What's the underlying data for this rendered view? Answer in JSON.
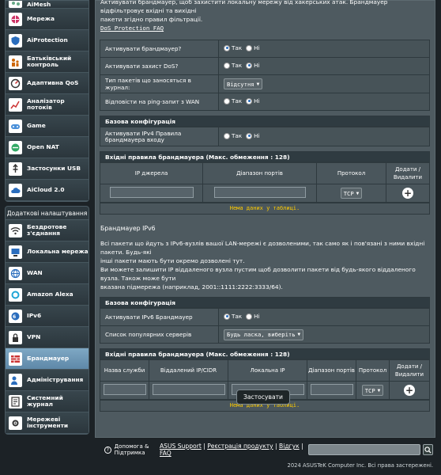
{
  "sidebar": {
    "items": [
      {
        "label": "AiMesh",
        "icon": "aimesh-icon"
      },
      {
        "label": "Мережа",
        "icon": "network-icon"
      },
      {
        "label": "AiProtection",
        "icon": "aiprotection-icon"
      },
      {
        "label": "Батьківський контроль",
        "icon": "parental-control-icon"
      },
      {
        "label": "Адаптивна QoS",
        "icon": "qos-icon"
      },
      {
        "label": "Аналізатор потоків",
        "icon": "traffic-analyzer-icon"
      },
      {
        "label": "Game",
        "icon": "game-icon"
      },
      {
        "label": "Open NAT",
        "icon": "open-nat-icon"
      },
      {
        "label": "Застосунки USB",
        "icon": "usb-icon"
      },
      {
        "label": "AiCloud 2.0",
        "icon": "aicloud-icon"
      }
    ],
    "advanced_header": "Додаткові налаштування",
    "advanced": [
      {
        "label": "Бездротове з'єднання",
        "icon": "wireless-icon"
      },
      {
        "label": "Локальна мережа",
        "icon": "lan-icon"
      },
      {
        "label": "WAN",
        "icon": "wan-icon"
      },
      {
        "label": "Amazon Alexa",
        "icon": "alexa-icon"
      },
      {
        "label": "IPv6",
        "icon": "ipv6-icon"
      },
      {
        "label": "VPN",
        "icon": "vpn-icon"
      },
      {
        "label": "Брандмауер",
        "icon": "firewall-icon"
      },
      {
        "label": "Адміністрування",
        "icon": "administration-icon"
      },
      {
        "label": "Системний журнал",
        "icon": "system-log-icon"
      },
      {
        "label": "Мережеві інструменти",
        "icon": "network-tools-icon"
      }
    ]
  },
  "intro": {
    "line1": "Активувати брандмауер, щоб захистити локальну мережу від хакерських атак. Брандмауер відфільтровує вхідні та вихідні",
    "line2": "пакети згідно правил фільтрації.",
    "faq": "DoS Protection FAQ"
  },
  "general": {
    "rows": [
      {
        "label": "Активувати брандмауер?",
        "type": "radio",
        "options": [
          "Так",
          "Ні"
        ],
        "selected": 0
      },
      {
        "label": "Активувати захист DoS?",
        "type": "radio",
        "options": [
          "Так",
          "Ні"
        ],
        "selected": 1
      },
      {
        "label": "Тип пакетів що заносяться в журнал:",
        "type": "select",
        "value": "Відсутня"
      },
      {
        "label": "Відповісти на ping-запит з WAN",
        "type": "radio",
        "options": [
          "Так",
          "Ні"
        ],
        "selected": 1
      }
    ]
  },
  "ipv4": {
    "basic_header": "Базова конфігурація",
    "rule_label": "Активувати IPv4 Правила брандмауера входу",
    "rule_options": [
      "Так",
      "Ні"
    ],
    "rule_selected": 1,
    "table_header": "Вхідні правила брандмауера (Макс. обмеження : 128)",
    "columns": [
      "IP джерела",
      "Діапазон портів",
      "Протокол",
      "Додати / Видалити"
    ],
    "protocol": "TCP",
    "no_data": "Нема даних у таблиці."
  },
  "ipv6": {
    "title": "Брандмауер IPv6",
    "desc1": "Всі пакети що йдуть з IPv6-вузлів вашої LAN-мережі є дозволеними, так само як і пов'язані з ними вхідні пакети. Будь-які",
    "desc2": "інші пакети мають бути окремо дозволені тут.",
    "desc3": "Ви можете залишити IP віддаленого вузла пустим щоб дозволити пакети від будь-якого віддаленого вузла. Також може бути",
    "desc4": "вказана підмережа (наприклад, 2001::1111:2222:3333/64).",
    "basic_header": "Базова конфігурація",
    "enable_label": "Активувати IPv6 Брандмауер",
    "enable_options": [
      "Так",
      "Ні"
    ],
    "enable_selected": 0,
    "servers_label": "Список популярних серверів",
    "servers_value": "Будь ласка, виберіть",
    "table_header": "Вхідні правила брандмауера (Макс. обмеження : 128)",
    "columns": [
      "Назва служби",
      "Віддалений IP/CIDR",
      "Локальна IP",
      "Діапазон портів",
      "Протокол",
      "Додати / Видалити"
    ],
    "protocol": "TCP",
    "no_data": "Нема даних у таблиці."
  },
  "apply_label": "Застосувати",
  "footer": {
    "help": "Допомога & Підтримка",
    "links": [
      "ASUS Support",
      "Реєстрація продукту",
      "Відгук",
      "FAQ"
    ],
    "copyright": "2024 ASUSTeK Computer Inc. Всі права застережені."
  }
}
